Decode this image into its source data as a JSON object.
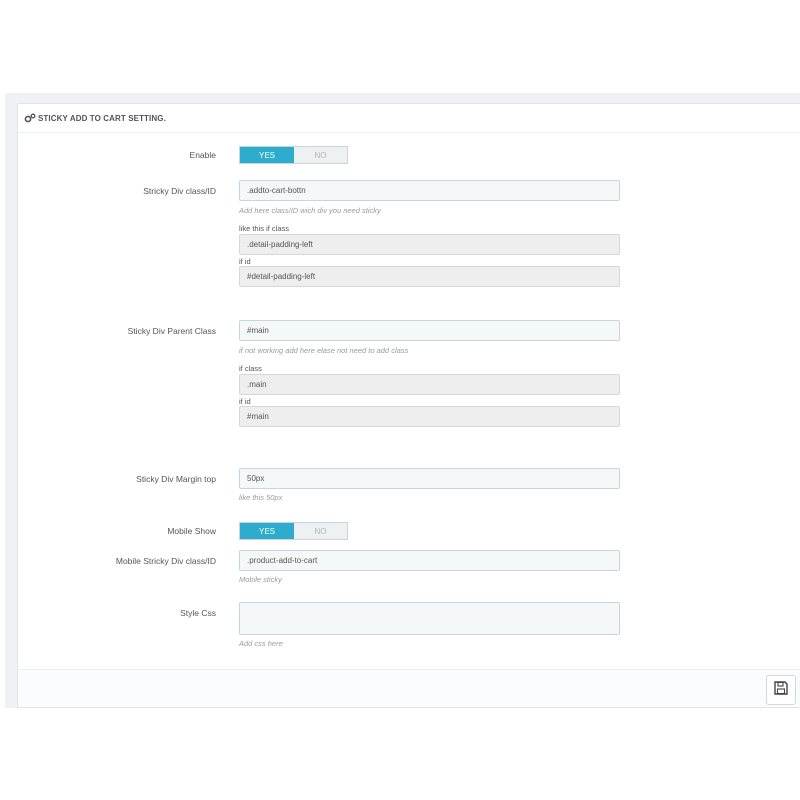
{
  "panel": {
    "title": "STICKY ADD TO CART SETTING.",
    "icon": "gears-icon"
  },
  "enable": {
    "label": "Enable",
    "yes": "YES",
    "no": "NO",
    "value": "YES"
  },
  "sticky_div": {
    "label": "Stricky Div class/ID",
    "value": ".addto-cart-bottn",
    "help": "Add here class/ID wich div you need sticky",
    "class_label": "like this if class",
    "class_example": ".detail-padding-left",
    "id_label": "if id",
    "id_example": "#detail-padding-left"
  },
  "parent_class": {
    "label": "Sticky Div Parent Class",
    "value": "#main",
    "help": "if not working add here elase not need to add class",
    "class_label": "if class",
    "class_example": ".main",
    "id_label": "if id",
    "id_example": "#main"
  },
  "margin_top": {
    "label": "Sticky Div Margin top",
    "value": "50px",
    "help": "like this 50px"
  },
  "mobile_show": {
    "label": "Mobile Show",
    "yes": "YES",
    "no": "NO",
    "value": "YES"
  },
  "mobile_div": {
    "label": "Mobile Stricky Div class/ID",
    "value": ".product-add-to-cart",
    "help": "Mobile sticky"
  },
  "style_css": {
    "label": "Style Css",
    "value": "",
    "help": "Add css here"
  },
  "footer": {
    "save_icon": "save-icon"
  },
  "colors": {
    "accent": "#2eacce",
    "input_bg": "#f5f8f9",
    "readonly_bg": "#eeeeee"
  }
}
